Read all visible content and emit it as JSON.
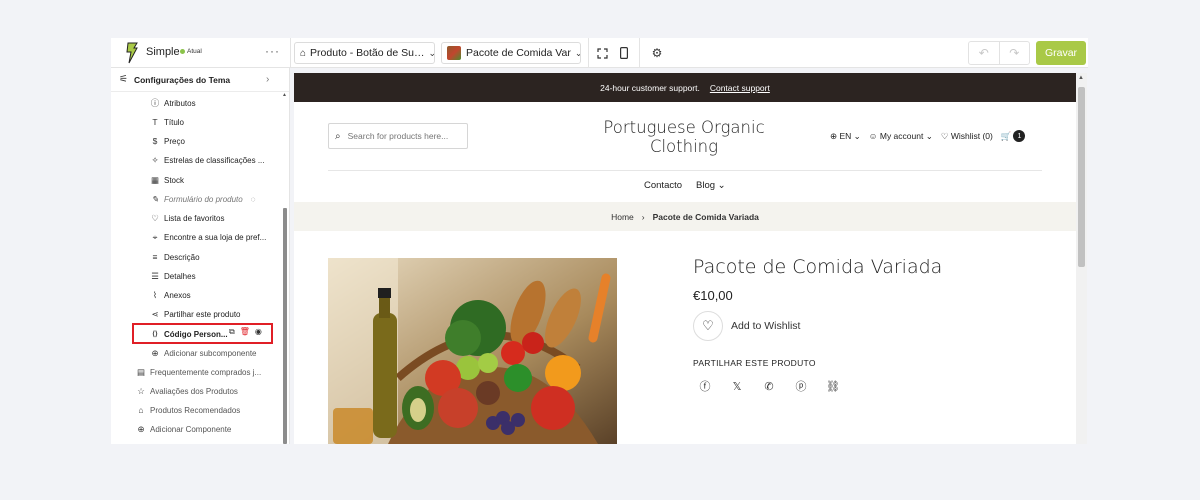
{
  "app": {
    "name": "Simple",
    "status": "Atual",
    "more": "···"
  },
  "toolbar": {
    "template_select": "Produto - Botão de Su…",
    "product_select": "Pacote de Comida Var",
    "save_label": "Gravar"
  },
  "sidebar": {
    "header": "Configurações do Tema",
    "items": [
      {
        "label": "Atributos",
        "icon": "info-icon"
      },
      {
        "label": "Título",
        "icon": "text-icon"
      },
      {
        "label": "Preço",
        "icon": "dollar-icon"
      },
      {
        "label": "Estrelas de classificações ...",
        "icon": "stars-icon"
      },
      {
        "label": "Stock",
        "icon": "stock-icon"
      },
      {
        "label": "Formulário do produto",
        "icon": "form-icon"
      },
      {
        "label": "Lista de favoritos",
        "icon": "heart-icon"
      },
      {
        "label": "Encontre a sua loja de pref...",
        "icon": "location-icon"
      },
      {
        "label": "Descrição",
        "icon": "align-icon"
      },
      {
        "label": "Detalhes",
        "icon": "list-icon"
      },
      {
        "label": "Anexos",
        "icon": "paperclip-icon"
      },
      {
        "label": "Partilhar este produto",
        "icon": "share-icon"
      },
      {
        "label": "Código Person...",
        "icon": "code-icon"
      },
      {
        "label": "Adicionar subcomponente",
        "icon": "add-icon"
      }
    ],
    "sections": [
      {
        "label": "Frequentemente comprados j...",
        "icon": "bundle-icon"
      },
      {
        "label": "Avaliações dos Produtos",
        "icon": "star-icon"
      },
      {
        "label": "Produtos Recomendados",
        "icon": "recommend-icon"
      },
      {
        "label": "Adicionar Componente",
        "icon": "add-icon"
      }
    ]
  },
  "preview": {
    "announcement": "24-hour customer support.",
    "announcement_link": "Contact support",
    "search_placeholder": "Search for products here...",
    "store_name": "Portuguese Organic Clothing",
    "language": "EN",
    "account": "My account",
    "wishlist": "Wishlist (0)",
    "cart_count": "1",
    "nav": [
      "Contacto",
      "Blog"
    ],
    "breadcrumb_home": "Home",
    "breadcrumb_current": "Pacote de Comida Variada",
    "product_title": "Pacote de Comida Variada",
    "product_price": "€10,00",
    "add_to_wishlist": "Add to Wishlist",
    "share_title": "PARTILHAR ESTE PRODUTO",
    "share_icons": [
      "facebook-icon",
      "x-icon",
      "whatsapp-icon",
      "pinterest-icon",
      "link-icon"
    ]
  },
  "colors": {
    "accent": "#a9c947",
    "highlight": "#e01f26",
    "announcement_bg": "#2c2421",
    "breadcrumb_bg": "#f4f3ee"
  }
}
